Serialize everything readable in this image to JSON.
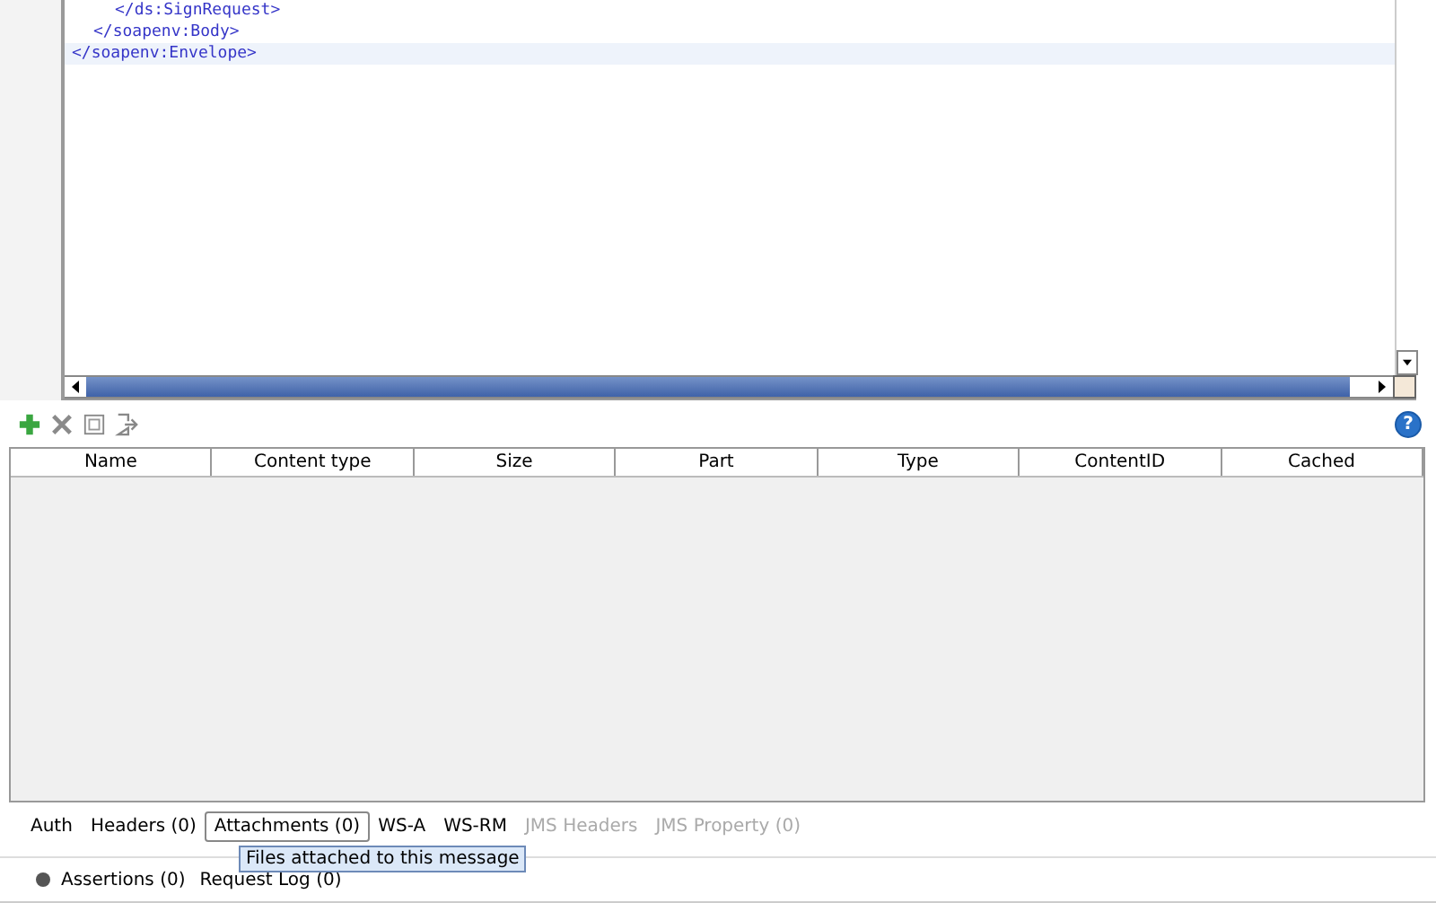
{
  "editor": {
    "closing_tags": [
      {
        "text": "</soapenv:Envelope>",
        "highlighted": true,
        "children": [
          {
            "text": "</soapenv:Body>",
            "highlighted": false,
            "children": [
              {
                "text": "</ds:SignRequest>",
                "highlighted": false
              }
            ]
          }
        ]
      }
    ]
  },
  "help_button": "?",
  "attachments_table": {
    "columns": [
      "Name",
      "Content type",
      "Size",
      "Part",
      "Type",
      "ContentID",
      "Cached"
    ]
  },
  "tabs": [
    {
      "label": "Auth",
      "selected": false,
      "disabled": false
    },
    {
      "label": "Headers (0)",
      "selected": false,
      "disabled": false
    },
    {
      "label": "Attachments (0)",
      "selected": true,
      "disabled": false
    },
    {
      "label": "WS-A",
      "selected": false,
      "disabled": false
    },
    {
      "label": "WS-RM",
      "selected": false,
      "disabled": false
    },
    {
      "label": "JMS Headers",
      "selected": false,
      "disabled": true
    },
    {
      "label": "JMS Property (0)",
      "selected": false,
      "disabled": true
    }
  ],
  "tooltip": "Files attached to this message",
  "bottom_tabs": [
    {
      "label": "Assertions (0)",
      "kind": "status"
    },
    {
      "label": "Request Log (0)",
      "kind": "plain"
    }
  ]
}
